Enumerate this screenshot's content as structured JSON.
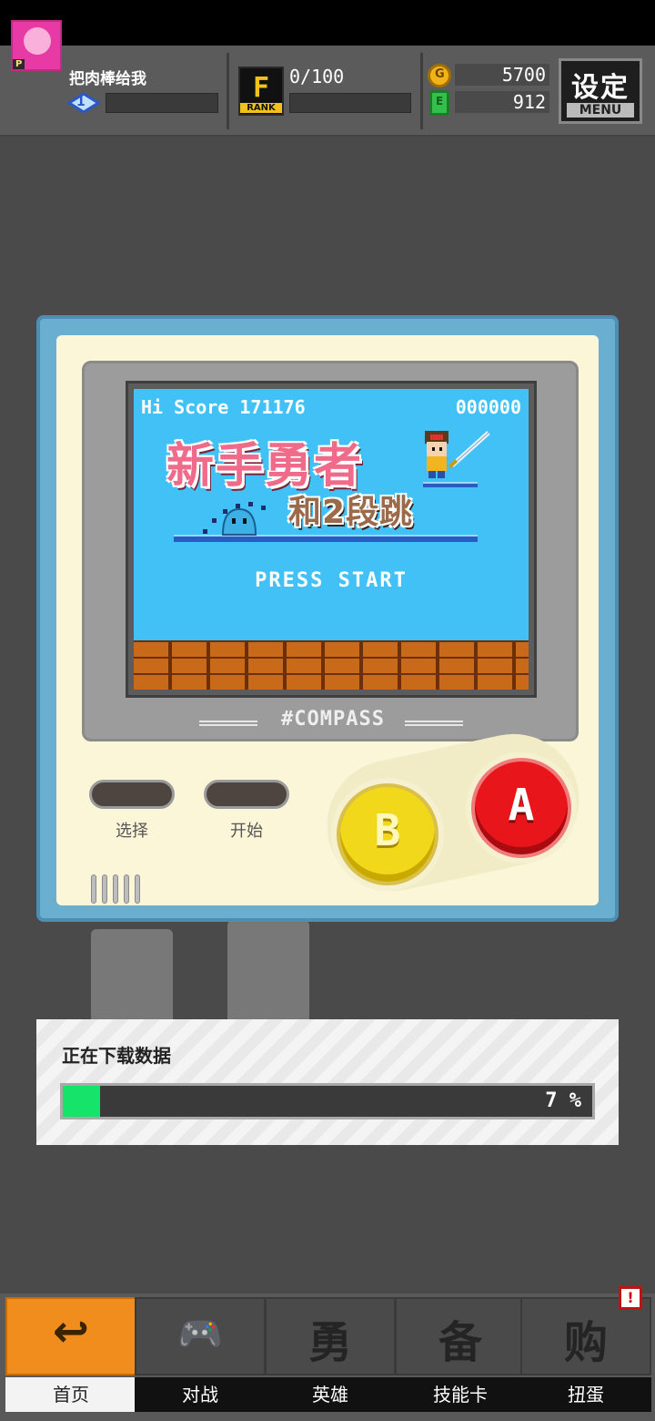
{
  "hud": {
    "player_name": "把肉棒给我",
    "avatar_tag": "P",
    "level": "1",
    "rank_letter": "F",
    "rank_word": "RANK",
    "rank_progress": "0/100",
    "coins": "5700",
    "gems": "912",
    "menu_label": "设定",
    "menu_sub": "MENU"
  },
  "game_screen": {
    "hi_score": "Hi Score 171176",
    "score": "000000",
    "title_line1": "新手勇者",
    "title_line2": "和2段跳",
    "press_start": "PRESS START",
    "device_label": "#COMPASS"
  },
  "console_buttons": {
    "select": "选择",
    "start": "开始",
    "b": "B",
    "a": "A"
  },
  "download": {
    "title": "正在下载数据",
    "progress_text": "7 %",
    "progress_value": 0.07,
    "fill_color": "#16e36a"
  },
  "bottom_nav": {
    "items": [
      {
        "label": "首页",
        "glyph": "↩",
        "icon": "home-return-icon",
        "active": true
      },
      {
        "label": "对战",
        "glyph": "🎮",
        "icon": "battle-icon",
        "active": false
      },
      {
        "label": "英雄",
        "glyph": "勇",
        "icon": "hero-icon",
        "active": false
      },
      {
        "label": "技能卡",
        "glyph": "备",
        "icon": "card-icon",
        "active": false
      },
      {
        "label": "扭蛋",
        "glyph": "购",
        "icon": "gacha-icon",
        "active": false
      }
    ],
    "alert": "!"
  },
  "colors": {
    "accent_orange": "#f08d1c",
    "screen_blue": "#41c1f5",
    "console_blue": "#6aaed0",
    "console_cream": "#fbf6d8"
  }
}
